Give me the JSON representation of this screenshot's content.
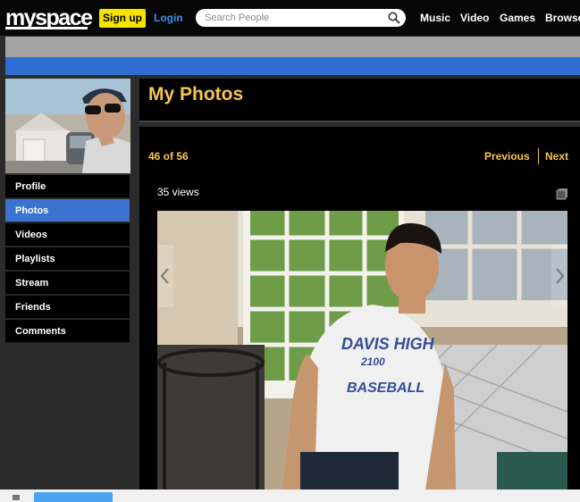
{
  "header": {
    "logo": "myspace",
    "signup_label": "Sign up",
    "login_label": "Login",
    "search_placeholder": "Search People",
    "nav": [
      "Music",
      "Video",
      "Games",
      "Browse"
    ]
  },
  "sidebar": {
    "items": [
      {
        "label": "Profile",
        "active": false
      },
      {
        "label": "Photos",
        "active": true
      },
      {
        "label": "Videos",
        "active": false
      },
      {
        "label": "Playlists",
        "active": false
      },
      {
        "label": "Stream",
        "active": false
      },
      {
        "label": "Friends",
        "active": false
      },
      {
        "label": "Comments",
        "active": false
      }
    ]
  },
  "page": {
    "title": "My Photos",
    "counter": "46 of 56",
    "previous_label": "Previous",
    "next_label": "Next",
    "views": "35 views",
    "shirt_text": [
      "DAVIS HIGH",
      "2100",
      "BASEBALL"
    ]
  },
  "colors": {
    "accent_gold": "#f7c454",
    "active_blue": "#3a73d0",
    "signup_yellow": "#f7e300",
    "login_blue": "#3d8fe6"
  },
  "icons": {
    "search": "magnifier-icon",
    "expand": "expand-icon",
    "prev_photo": "chevron-left-icon",
    "next_photo": "chevron-right-icon"
  }
}
